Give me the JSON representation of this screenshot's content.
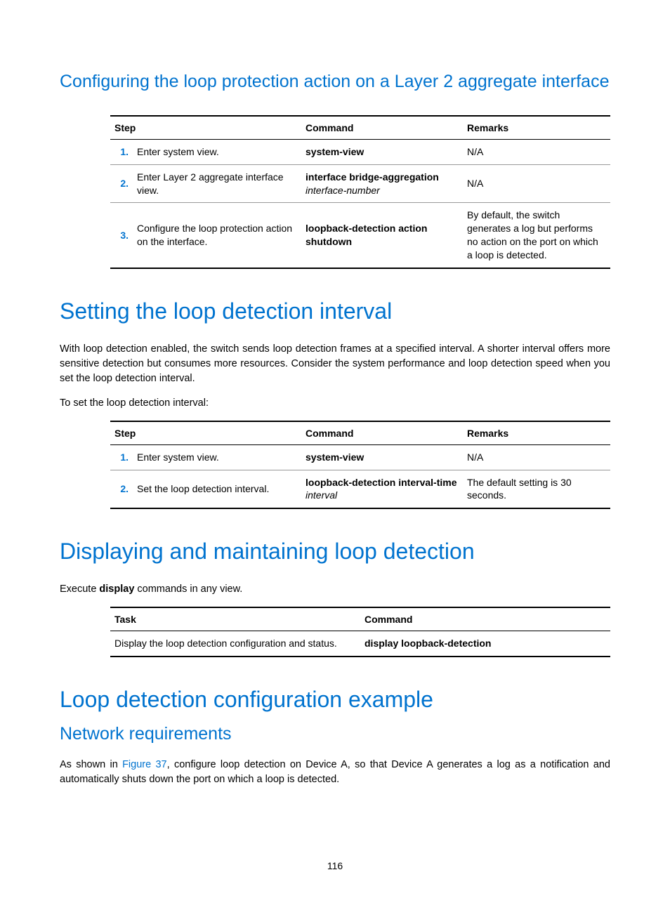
{
  "sec1": {
    "title": "Configuring the loop protection action on a Layer 2 aggregate interface",
    "headers": {
      "step": "Step",
      "cmd": "Command",
      "rem": "Remarks"
    },
    "rows": [
      {
        "n": "1.",
        "step": "Enter system view.",
        "cmd_b": "system-view",
        "cmd_i": "",
        "rem": "N/A"
      },
      {
        "n": "2.",
        "step": "Enter Layer 2 aggregate interface view.",
        "cmd_b": "interface bridge-aggregation",
        "cmd_i": "interface-number",
        "rem": "N/A"
      },
      {
        "n": "3.",
        "step": "Configure the loop protection action on the interface.",
        "cmd_b": "loopback-detection action shutdown",
        "cmd_i": "",
        "rem": "By default, the switch generates a log but performs no action on the port on which a loop is detected."
      }
    ]
  },
  "sec2": {
    "title": "Setting the loop detection interval",
    "para": "With loop detection enabled, the switch sends loop detection frames at a specified interval. A shorter interval offers more sensitive detection but consumes more resources. Consider the system performance and loop detection speed when you set the loop detection interval.",
    "lead": "To set the loop detection interval:",
    "headers": {
      "step": "Step",
      "cmd": "Command",
      "rem": "Remarks"
    },
    "rows": [
      {
        "n": "1.",
        "step": "Enter system view.",
        "cmd_b": "system-view",
        "cmd_i": "",
        "rem": "N/A"
      },
      {
        "n": "2.",
        "step": "Set the loop detection interval.",
        "cmd_b": "loopback-detection interval-time",
        "cmd_i": "interval",
        "rem": "The default setting is 30 seconds."
      }
    ]
  },
  "sec3": {
    "title": "Displaying and maintaining loop detection",
    "para_pre": "Execute ",
    "para_bold": "display",
    "para_post": " commands in any view.",
    "headers": {
      "task": "Task",
      "cmd": "Command"
    },
    "rows": [
      {
        "task": "Display the loop detection configuration and status.",
        "cmd": "display loopback-detection"
      }
    ]
  },
  "sec4": {
    "title": "Loop detection configuration example",
    "sub": "Network requirements",
    "para_pre": "As shown in ",
    "link": "Figure 37",
    "para_post": ", configure loop detection on Device A, so that Device A generates a log as a notification and automatically shuts down the port on which a loop is detected."
  },
  "pagenum": "116"
}
